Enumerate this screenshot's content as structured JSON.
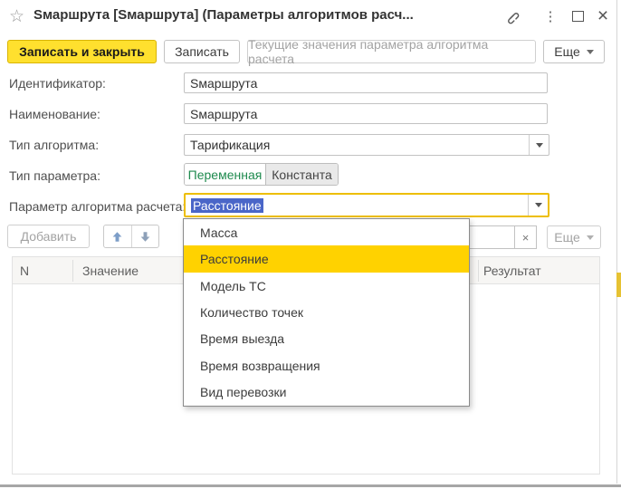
{
  "window": {
    "title": "Sмаршрута [Sмаршрута] (Параметры алгоритмов расч...",
    "star_glyph": "☆",
    "kebab_glyph": "⋮",
    "close_glyph": "×"
  },
  "toolbar": {
    "save_close_label": "Записать и закрыть",
    "save_label": "Записать",
    "current_values_label": "Текущие значения параметра алгоритма расчета",
    "more_label": "Еще"
  },
  "form": {
    "identifier": {
      "label": "Идентификатор:",
      "value": "Sмаршрута"
    },
    "name": {
      "label": "Наименование:",
      "value": "Sмаршрута"
    },
    "algorithm_type": {
      "label": "Тип алгоритма:",
      "value": "Тарификация"
    },
    "parameter_type": {
      "label": "Тип параметра:",
      "option_variable": "Переменная",
      "option_constant": "Константа",
      "selected": "Переменная"
    },
    "algorithm_parameter": {
      "label": "Параметр алгоритма расчета:",
      "value": "Расстояние"
    }
  },
  "dropdown": {
    "items": [
      "Масса",
      "Расстояние",
      "Модель ТС",
      "Количество точек",
      "Время выезда",
      "Время возвращения",
      "Вид перевозки"
    ],
    "highlighted": "Расстояние"
  },
  "table_toolbar": {
    "add_label": "Добавить",
    "more_label": "Еще",
    "search_value": "",
    "clear_glyph": "×"
  },
  "table": {
    "columns": [
      "N",
      "Значение",
      "Результат"
    ]
  },
  "colors": {
    "accent_yellow": "#ffe02e",
    "highlight_yellow": "#ffd200",
    "focus_border": "#edbe00",
    "selection_blue": "#4a66c8",
    "active_green": "#1e8a4e",
    "disabled_text": "#a3a3a3"
  }
}
